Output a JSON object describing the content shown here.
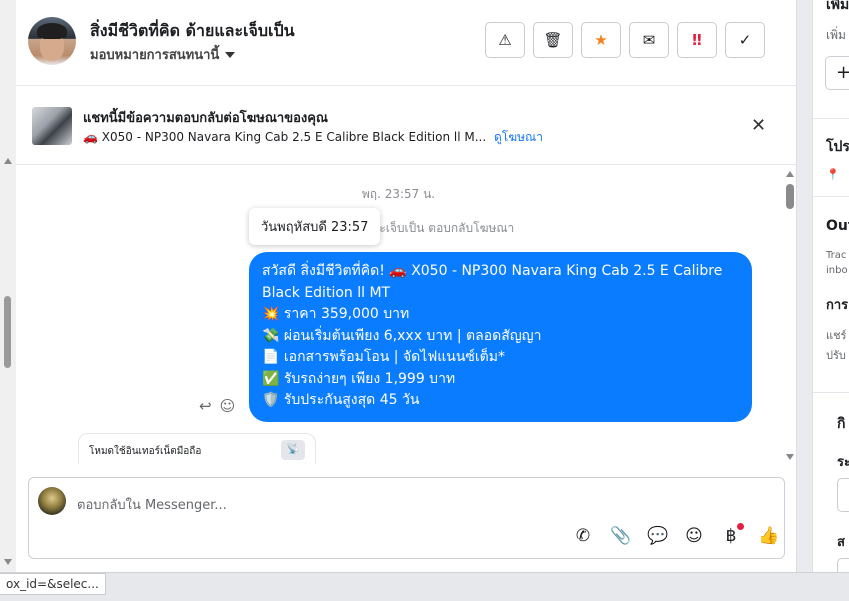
{
  "header": {
    "name": "สิ่งมีชีวิตที่คิด ด้ายและเจ็บเป็น",
    "assign_label": "มอบหมายการสนทนานี้",
    "actions": [
      {
        "name": "spam-button",
        "icon": "⚠"
      },
      {
        "name": "delete-button",
        "icon": "🗑"
      },
      {
        "name": "star-button",
        "icon": "★"
      },
      {
        "name": "mark-unread-button",
        "icon": "✉"
      },
      {
        "name": "follow-up-button",
        "icon": "‼"
      },
      {
        "name": "done-button",
        "icon": "✓"
      }
    ]
  },
  "ad": {
    "title": "แชทนี้มีข้อความตอบกลับต่อโฆษณาของคุณ",
    "car_icon": "🚗",
    "subtitle": "X050 - NP300 Navara King Cab 2.5 E Calibre Black Edition ll M...",
    "link": "ดูโฆษณา",
    "close": "✕"
  },
  "chat": {
    "timestamp": "พฤ. 23:57 น.",
    "tooltip": "วันพฤหัสบดี 23:57",
    "replied_note": "ละเจ็บเป็น ตอบกลับโฆษณา",
    "message_lines": [
      "สวัสดี สิ่งมีชีวิตที่คิด! 🚗 X050 - NP300 Navara King Cab 2.5 E Calibre Black Edition ll MT",
      "💥 ราคา 359,000 บาท",
      "💸 ผ่อนเริ่มต้นเพียง 6,xxx บาท | ตลอดสัญญา",
      "📄 เอกสารพร้อมโอน | จัดไฟแนนซ์เต็ม*",
      "✅ รับรถง่ายๆ เพียง 1,999 บาท",
      "🛡️ รับประกันสูงสุด 45 วัน"
    ],
    "reply_icon": "↩",
    "react_icon": "☺",
    "card_label": "โหมดใช้อินเทอร์เน็ตมือถือ",
    "card_icon": "📡"
  },
  "composer": {
    "placeholder": "ตอบกลับใน Messenger...",
    "tools": [
      {
        "name": "call-icon",
        "glyph": "✆"
      },
      {
        "name": "attach-icon",
        "glyph": "📎"
      },
      {
        "name": "saved-reply-icon",
        "glyph": "💬"
      },
      {
        "name": "emoji-icon",
        "glyph": "☺"
      },
      {
        "name": "payment-icon",
        "glyph": "฿"
      },
      {
        "name": "like-icon",
        "glyph": "👍"
      }
    ]
  },
  "right_panel": {
    "t1": "เพิ่ม",
    "t2": "เพิ่ม",
    "plus": "+",
    "t3": "โปร",
    "pin": "📍",
    "t4": "Out",
    "t5a": "Trac",
    "t5b": "inbo",
    "t6": "การ",
    "t7a": "แชร์",
    "t7b": "ปรับ",
    "t8": "กิ",
    "t9": "ระ",
    "t10": "ส"
  },
  "status_bar": {
    "url": "ox_id=&selec..."
  },
  "colors": {
    "bubble": "#0a7cff",
    "link": "#1877f2",
    "star": "#f58220",
    "urgent": "#e41e3f"
  }
}
